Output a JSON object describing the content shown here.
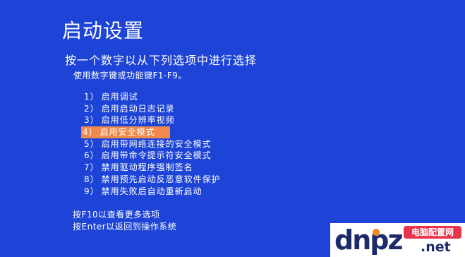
{
  "screen": {
    "title": "启动设置",
    "instruction": "按一个数字以从下列选项中进行选择",
    "hint": "使用数字键或功能键F1-F9。"
  },
  "options": [
    {
      "number": "1）",
      "label": "启用调试",
      "selected": false
    },
    {
      "number": "2）",
      "label": "启用启动日志记录",
      "selected": false
    },
    {
      "number": "3）",
      "label": "启用低分辨率视频",
      "selected": false
    },
    {
      "number": "4）",
      "label": "启用安全模式",
      "selected": true
    },
    {
      "number": "5）",
      "label": "启用带网络连接的安全模式",
      "selected": false
    },
    {
      "number": "6）",
      "label": "启用带命令提示符安全模式",
      "selected": false
    },
    {
      "number": "7）",
      "label": "禁用驱动程序强制签名",
      "selected": false
    },
    {
      "number": "8）",
      "label": "禁用预先启动反恶意软件保护",
      "selected": false
    },
    {
      "number": "9）",
      "label": "禁用失败后自动重新启动",
      "selected": false
    }
  ],
  "footer": {
    "more": "按F10以查看更多选项",
    "return": "按Enter以返回到操作系统"
  },
  "watermark": {
    "logo_text": "dnpz",
    "site_name": "电脑配置网",
    "domain_suffix": ".net"
  },
  "colors": {
    "background": "#1d44d6",
    "highlight": "#ef8a4c",
    "text": "#ffffff"
  }
}
